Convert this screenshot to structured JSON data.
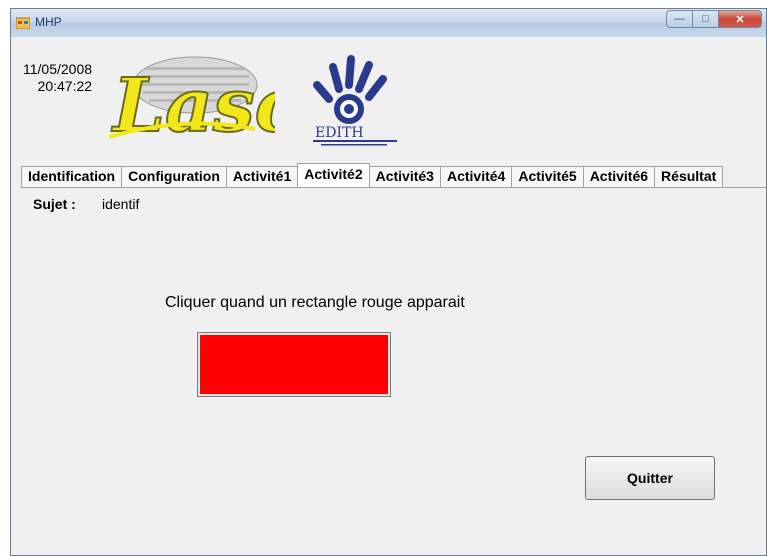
{
  "window": {
    "title": "MHP"
  },
  "header": {
    "date": "11/05/2008",
    "time": "20:47:22"
  },
  "tabs": [
    {
      "label": "Identification",
      "active": false
    },
    {
      "label": "Configuration",
      "active": false
    },
    {
      "label": "Activité1",
      "active": false
    },
    {
      "label": "Activité2",
      "active": true
    },
    {
      "label": "Activité3",
      "active": false
    },
    {
      "label": "Activité4",
      "active": false
    },
    {
      "label": "Activité5",
      "active": false
    },
    {
      "label": "Activité6",
      "active": false
    },
    {
      "label": "Résultat",
      "active": false
    }
  ],
  "main": {
    "sujet_label": "Sujet :",
    "sujet_value": "identif",
    "instruction": "Cliquer quand un rectangle rouge apparait",
    "quit_label": "Quitter"
  },
  "colors": {
    "target": "#ff0000",
    "background": "#f0f0f0"
  },
  "logos": {
    "lasc": "Lasc",
    "edith": "EDITH"
  }
}
